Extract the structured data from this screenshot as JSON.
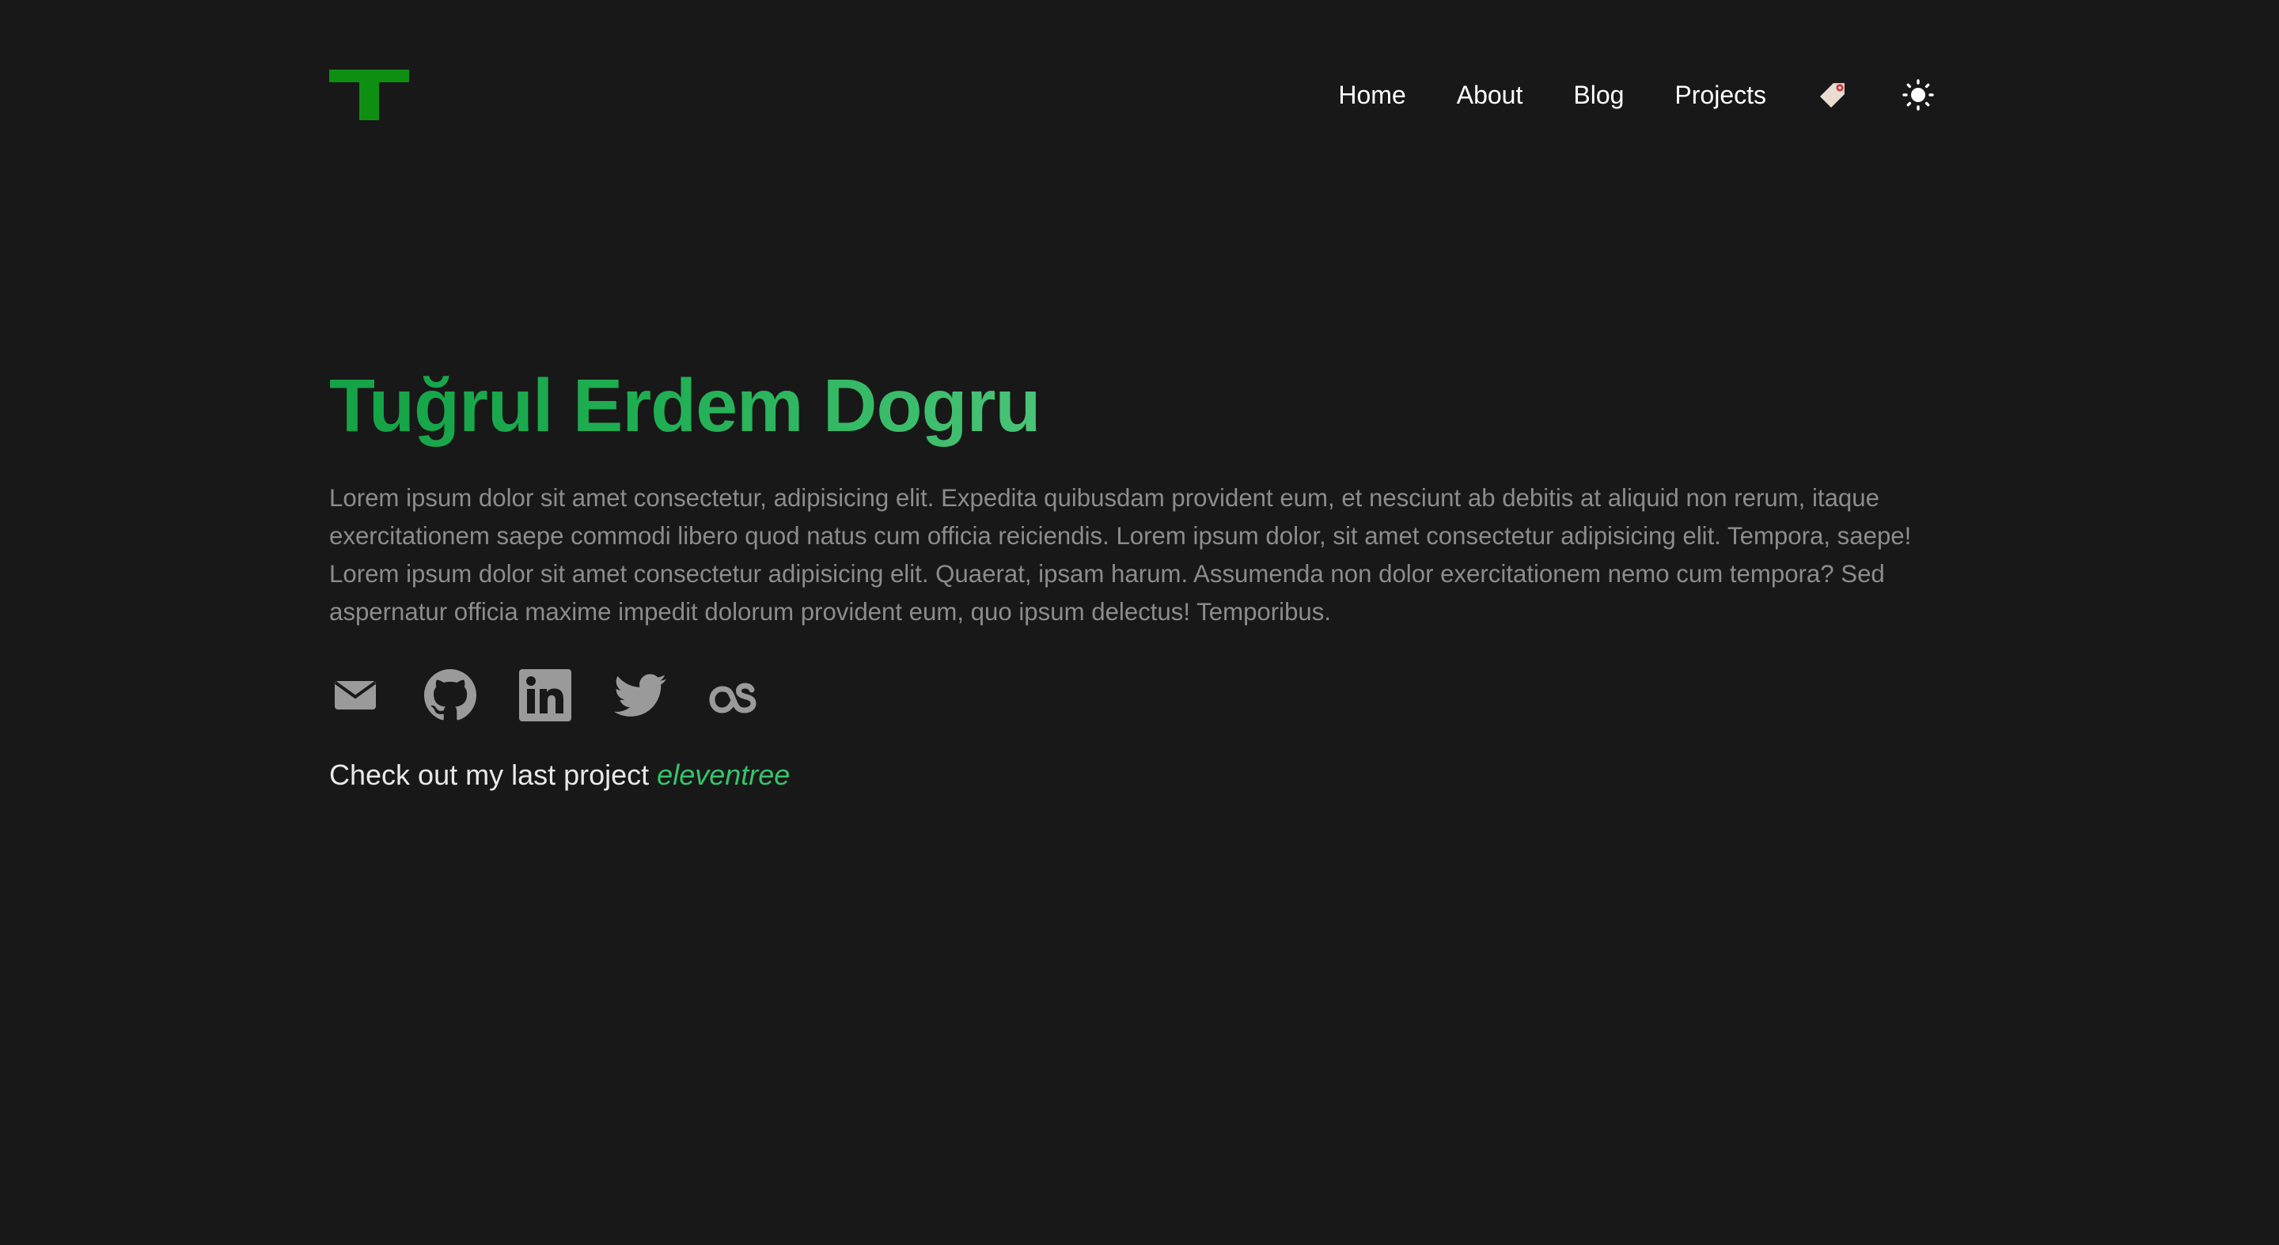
{
  "header": {
    "logo_icon": "brand-t-logo",
    "nav": [
      {
        "label": "Home"
      },
      {
        "label": "About"
      },
      {
        "label": "Blog"
      },
      {
        "label": "Projects"
      }
    ],
    "language_icon": "tag-icon",
    "theme_icon": "sun-icon"
  },
  "hero": {
    "title": "Tuğrul Erdem Dogru",
    "description": "Lorem ipsum dolor sit amet consectetur, adipisicing elit. Expedita quibusdam provident eum, et nesciunt ab debitis at aliquid non rerum, itaque exercitationem saepe commodi libero quod natus cum officia reiciendis. Lorem ipsum dolor, sit amet consectetur adipisicing elit. Tempora, saepe! Lorem ipsum dolor sit amet consectetur adipisicing elit. Quaerat, ipsam harum. Assumenda non dolor exercitationem nemo cum tempora? Sed aspernatur officia maxime impedit dolorum provident eum, quo ipsum delectus! Temporibus.",
    "socials": [
      {
        "icon": "mail-icon"
      },
      {
        "icon": "github-icon"
      },
      {
        "icon": "linkedin-icon"
      },
      {
        "icon": "twitter-icon"
      },
      {
        "icon": "lastfm-icon"
      }
    ],
    "cta_text": "Check out my last project",
    "cta_link": "eleventree"
  },
  "colors": {
    "background": "#181818",
    "accent": "#1fae52",
    "logo": "#0e8f12",
    "muted": "#8c8c8c"
  }
}
